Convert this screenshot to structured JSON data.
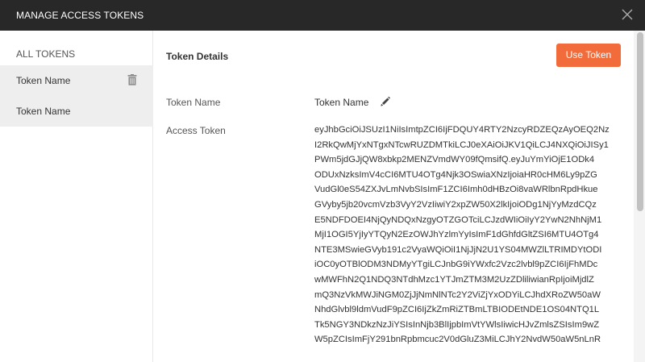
{
  "window": {
    "title": "MANAGE ACCESS TOKENS"
  },
  "sidebar": {
    "header": "ALL TOKENS",
    "items": [
      {
        "label": "Token Name"
      },
      {
        "label": "Token Name"
      }
    ]
  },
  "details": {
    "section_title": "Token Details",
    "use_token_label": "Use Token",
    "token_name_label": "Token Name",
    "token_name_value": "Token Name",
    "access_token_label": "Access Token",
    "access_token_lines": [
      "eyJhbGciOiJSUzI1NiIsImtpZCI6IjFDQUY4RTY2NzcyRDZEQzAyOEQ2Nz",
      "I2RkQwMjYxNTgxNTcwRUZDMTkiLCJ0eXAiOiJKV1QiLCJ4NXQiOiJISy1",
      "PWm5jdGJjQW8xbkp2MENZVmdWY09fQmsifQ.eyJuYmYiOjE1ODk4",
      "ODUxNzksImV4cCI6MTU4OTg4Njk3OSwiaXNzIjoiaHR0cHM6Ly9pZG",
      "VudGl0eS54ZXJvLmNvbSIsImF1ZCI6Imh0dHBzOi8vaWRlbnRpdHkue",
      "GVyby5jb20vcmVzb3VyY2VzIiwiY2xpZW50X2lkIjoiODg1NjYyMzdCQz",
      "E5NDFDOEI4NjQyNDQxNzgyOTZGOTciLCJzdWIiOiIyY2YwN2NhNjM1",
      "MjI1OGI5YjIyYTQyN2EzOWJhYzlmYyIsImF1dGhfdGltZSI6MTU4OTg4",
      "NTE3MSwieGVyb191c2VyaWQiOiI1NjJjN2U1YS04MWZlLTRIMDYtODI",
      "iOC0yOTBlODM3NDMyYTgiLCJnbG9iYWxfc2Vzc2lvbl9pZCI6IjFhMDc",
      "wMWFhN2Q1NDQ3NTdhMzc1YTJmZTM3M2UzZDliliwianRpIjoiMjdlZ",
      "mQ3NzVkMWJiNGM0ZjJjNmNlNTc2Y2ViZjYxODYiLCJhdXRoZW50aW",
      "NhdGlvbl9ldmVudF9pZCI6IjZkZmRiZTBmLTBIODEtNDE1OS04NTQ1L",
      "Tk5NGY3NDkzNzJiYSIsInNjb3BlIjpbImVtYWlsIiwicHJvZmlsZSIsIm9wZ",
      "W5pZCIsImFjY291bnRpbmcuc2V0dGluZ3MiLCJhY2NvdW50aW5nLnR"
    ]
  }
}
